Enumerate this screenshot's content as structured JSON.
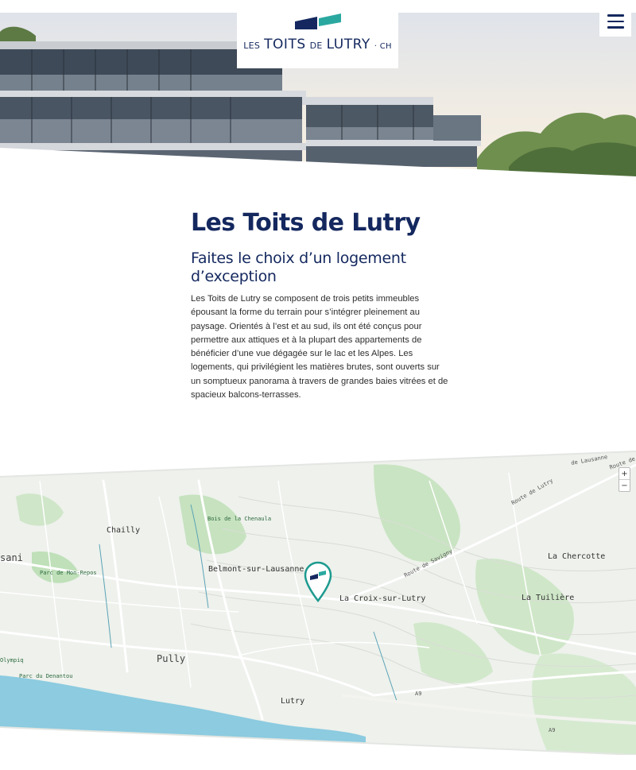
{
  "header": {
    "logo": {
      "les": "LES",
      "toits": "TOITS",
      "de": "DE",
      "lutry": "LUTRY",
      "tld": "· CH",
      "colors": {
        "navy": "#14285f",
        "teal": "#2aa8a0"
      }
    },
    "menu_icon": "hamburger-menu-icon"
  },
  "main": {
    "title": "Les Toits de Lutry",
    "subtitle": "Faites le choix d’un logement d’exception",
    "body": "Les Toits de Lutry se composent de trois petits immeubles épousant la forme du terrain pour s’intégrer pleinement au paysage. Orientés à l’est et au sud, ils ont été conçus pour permettre aux attiques et à la plupart des appartements de bénéficier d’une vue dégagée sur le lac et les Alpes. Les logements, qui privilégient les matières brutes, sont ouverts sur un somptueux panorama à travers de grandes baies vitrées et de spacieux balcons-terrasses."
  },
  "map": {
    "zoom_in": "+",
    "zoom_out": "−",
    "labels": {
      "chailly": "Chailly",
      "bois": "Bois de la Chenaula",
      "belmont": "Belmont-sur-Lausanne",
      "croix": "La Croix-sur-Lutry",
      "chercotte": "La Chercotte",
      "tuiliere": "La Tuilière",
      "pully": "Pully",
      "lutry": "Lutry",
      "lausanne_partial": "sani",
      "parc_mon_repos": "Parc de Mon-Repos",
      "olympiq": "Olympiq",
      "parc_denantou": "Parc du Denantou",
      "route_lutry": "Route de Lutry",
      "route_savigny": "Route de Savigny",
      "route_lausanne": "de Lausanne",
      "route_de": "Route de",
      "a9_1": "A9",
      "a9_2": "A9"
    },
    "colors": {
      "land": "#eef1ec",
      "forest": "#c7e3c0",
      "lake": "#8ccbe0",
      "road": "#ffffff",
      "pin": "#1d9a8f"
    }
  }
}
